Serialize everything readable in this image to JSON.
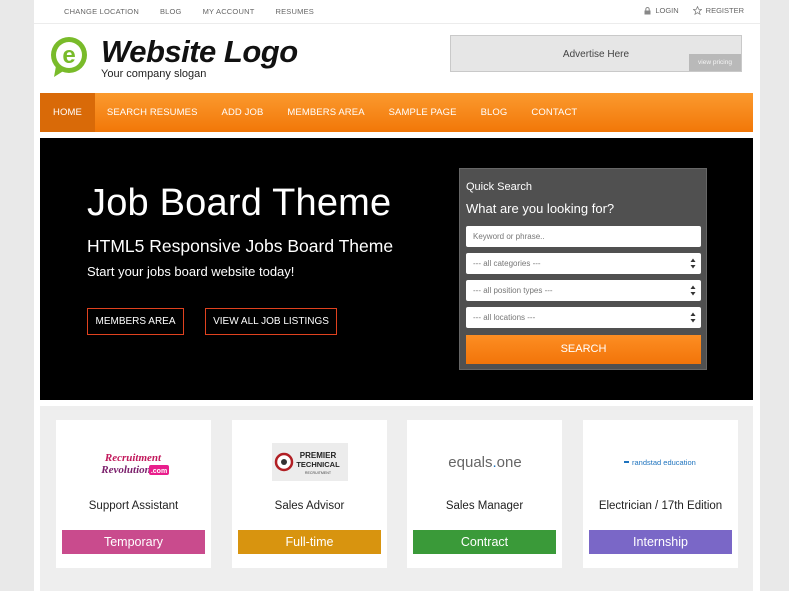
{
  "topbar": {
    "links": [
      "CHANGE LOCATION",
      "BLOG",
      "MY ACCOUNT",
      "RESUMES"
    ],
    "login": "LOGIN",
    "register": "REGISTER"
  },
  "header": {
    "logo_letter": "e",
    "logo_title": "Website Logo",
    "slogan": "Your company slogan",
    "ad_label": "Advertise Here",
    "ad_pricing": "view pricing"
  },
  "nav": {
    "items": [
      "HOME",
      "SEARCH RESUMES",
      "ADD JOB",
      "MEMBERS AREA",
      "SAMPLE PAGE",
      "BLOG",
      "CONTACT"
    ],
    "active_index": 0
  },
  "hero": {
    "title": "Job Board Theme",
    "subtitle": "HTML5 Responsive Jobs Board Theme",
    "text": "Start your jobs board website today!",
    "button_members": "MEMBERS AREA",
    "button_listings": "VIEW ALL JOB LISTINGS"
  },
  "quick_search": {
    "title": "Quick Search",
    "subtitle": "What are you looking for?",
    "keyword_placeholder": "Keyword or phrase..",
    "categories": "--- all categories ---",
    "position_types": "--- all position types ---",
    "locations": "--- all locations ---",
    "search_label": "SEARCH"
  },
  "jobs": [
    {
      "company_logo": "Recruitment Revolution.com",
      "title": "Support Assistant",
      "type": "Temporary",
      "color": "#c94b8d"
    },
    {
      "company_logo": "PREMIER TECHNICAL RECRUITMENT",
      "title": "Sales Advisor",
      "type": "Full-time",
      "color": "#d8940f"
    },
    {
      "company_logo": "equals.one",
      "title": "Sales Manager",
      "type": "Contract",
      "color": "#3a9a39"
    },
    {
      "company_logo": "randstad education",
      "title": "Electrician / 17th Edition",
      "type": "Internship",
      "color": "#7a67c7"
    }
  ],
  "colors": {
    "brand_orange": "#f27708",
    "logo_green": "#79bb2a",
    "button_border": "#e0421f"
  }
}
